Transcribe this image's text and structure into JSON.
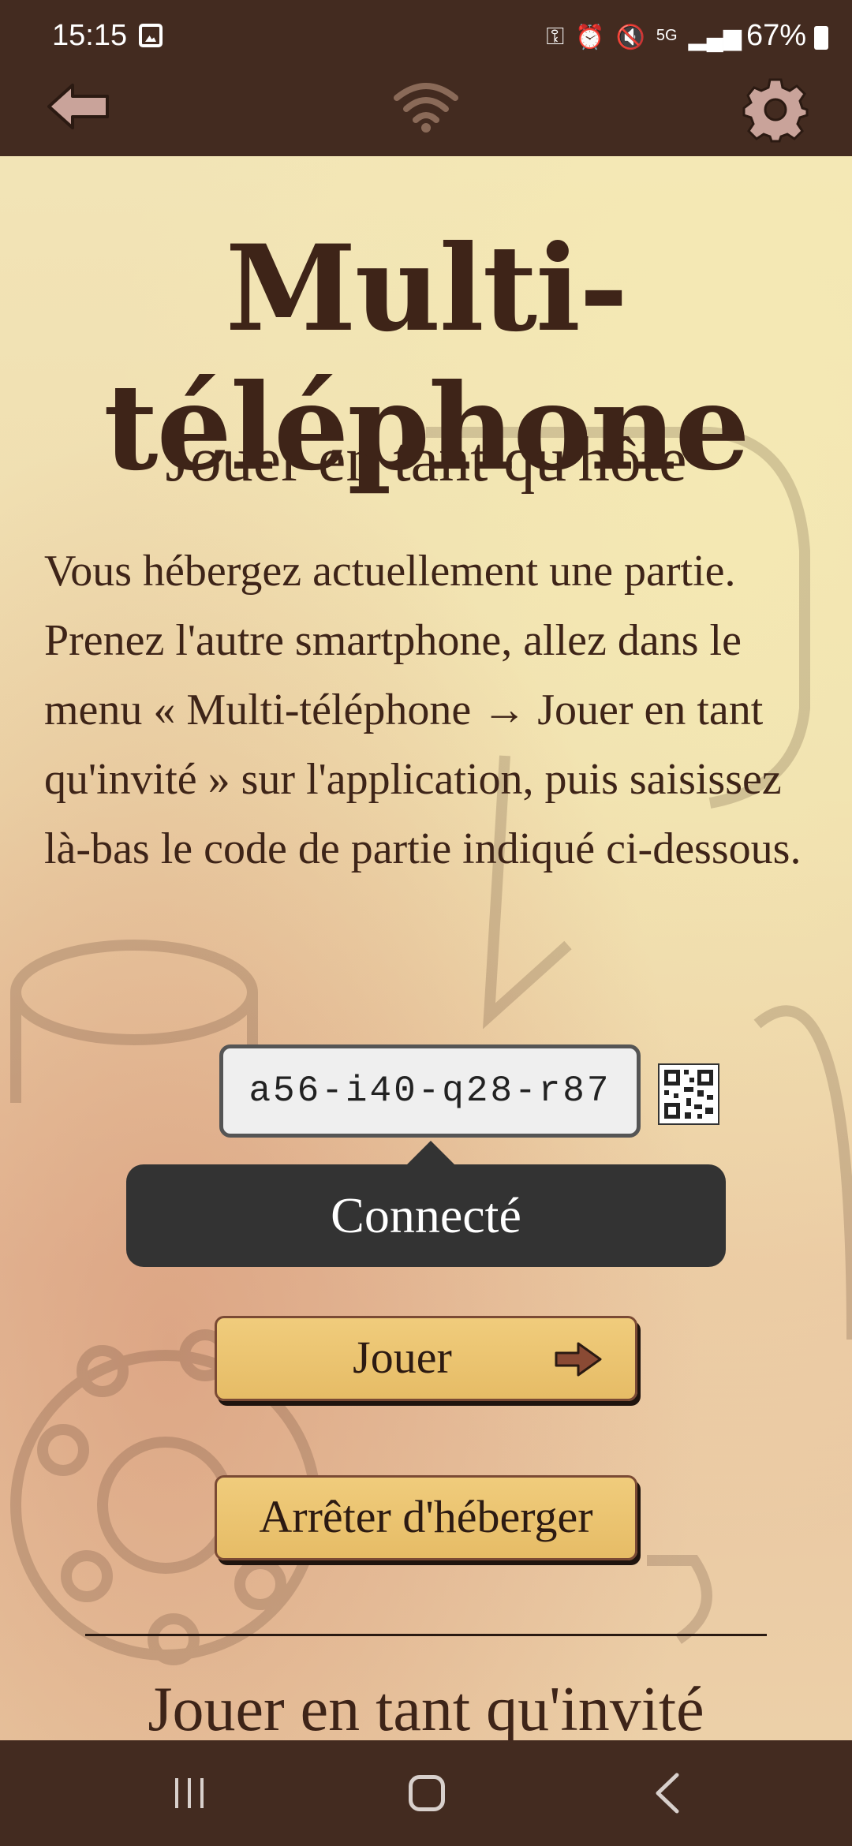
{
  "status_bar": {
    "time": "15:15",
    "battery": "67%",
    "network": "5G"
  },
  "page": {
    "title": "Multi-téléphone",
    "host_heading": "Jouer en tant qu'hôte",
    "description": "Vous hébergez actuellement une partie. Prenez l'autre smartphone, allez dans le menu « Multi-téléphone → Jouer en tant qu'invité » sur l'application, puis saisissez là-bas le code de partie indiqué ci-dessous.",
    "game_code": "a56-i40-q28-r87",
    "status_tooltip": "Connecté",
    "play_button": "Jouer",
    "stop_hosting_button": "Arrêter d'héberger",
    "guest_heading": "Jouer en tant qu'invité"
  },
  "colors": {
    "bar_bg": "#432b20",
    "text_brown": "#3e2418",
    "button_gold": "#ecc46e",
    "tooltip_bg": "#333333"
  },
  "icons": [
    "back-arrow-icon",
    "wifi-icon",
    "gear-icon",
    "qr-code-icon",
    "arrow-right-icon",
    "recent-apps-icon",
    "home-icon",
    "nav-back-icon"
  ]
}
